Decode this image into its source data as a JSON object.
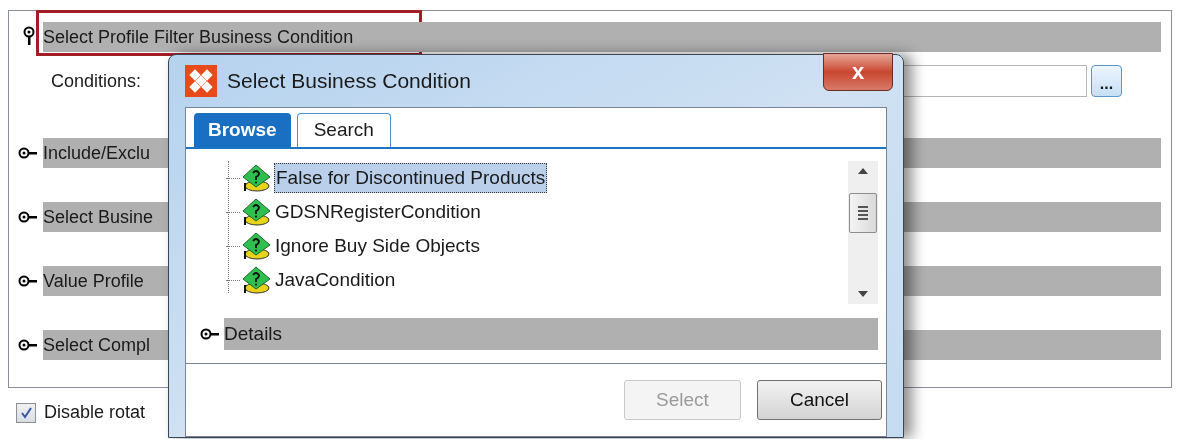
{
  "sections": [
    {
      "title": "Select Profile Filter Business Condition",
      "expanded": true,
      "highlighted": true
    },
    {
      "title": "Include/Exclu",
      "expanded": false,
      "highlighted": false
    },
    {
      "title": "Select Busine",
      "expanded": false,
      "highlighted": false
    },
    {
      "title": "Value Profile",
      "expanded": false,
      "highlighted": false
    },
    {
      "title": "Select Compl",
      "expanded": false,
      "highlighted": false
    }
  ],
  "conditions": {
    "label": "Conditions:",
    "browse_button": "..."
  },
  "disable_rotation": {
    "label": "Disable rotat",
    "checked": true
  },
  "dialog": {
    "title": "Select Business Condition",
    "close": "x",
    "tabs": [
      {
        "label": "Browse",
        "selected": true
      },
      {
        "label": "Search",
        "selected": false
      }
    ],
    "tree_items": [
      {
        "label": "False for Discontinued Products",
        "selected": true
      },
      {
        "label": "GDSNRegisterCondition",
        "selected": false
      },
      {
        "label": "Ignore Buy Side Objects",
        "selected": false
      },
      {
        "label": "JavaCondition",
        "selected": false
      }
    ],
    "details": {
      "title": "Details",
      "expanded": false
    },
    "buttons": [
      {
        "label": "Select",
        "disabled": true
      },
      {
        "label": "Cancel",
        "disabled": false
      }
    ]
  }
}
